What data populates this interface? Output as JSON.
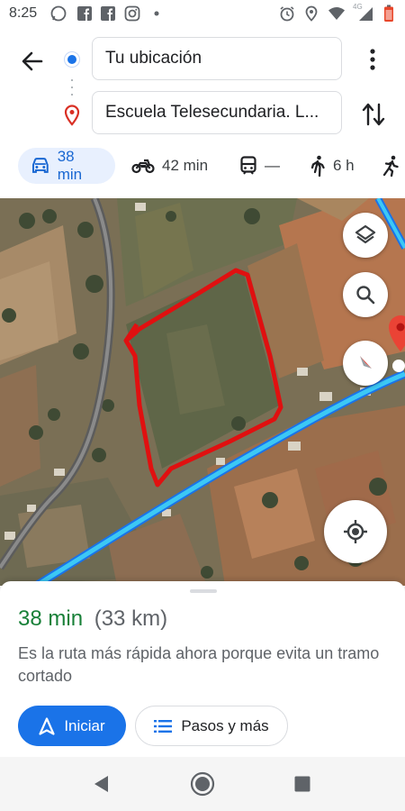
{
  "status_bar": {
    "time": "8:25",
    "network": "4G",
    "icons": [
      "whatsapp-icon",
      "facebook-icon",
      "facebook-icon",
      "instagram-icon",
      "dot-icon",
      "alarm-icon",
      "location-icon",
      "wifi-icon",
      "signal-icon",
      "battery-icon"
    ]
  },
  "directions": {
    "origin": "Tu ubicación",
    "destination": "Escuela Telesecundaria. L...",
    "modes": [
      {
        "icon": "car-icon",
        "label": "38 min",
        "active": true
      },
      {
        "icon": "motorcycle-icon",
        "label": "42 min",
        "active": false
      },
      {
        "icon": "transit-icon",
        "label": "—",
        "active": false
      },
      {
        "icon": "walk-icon",
        "label": "6 h",
        "active": false
      },
      {
        "icon": "run-icon",
        "label": "",
        "active": false
      }
    ]
  },
  "route": {
    "duration": "38 min",
    "distance": "(33 km)",
    "description": "Es la ruta más rápida ahora porque evita un tramo cortado",
    "start_label": "Iniciar",
    "steps_label": "Pasos y más"
  },
  "colors": {
    "accent": "#1a73e8",
    "duration_green": "#188038",
    "route_line": "#2ec4f0",
    "annotation_red": "#e01010"
  }
}
